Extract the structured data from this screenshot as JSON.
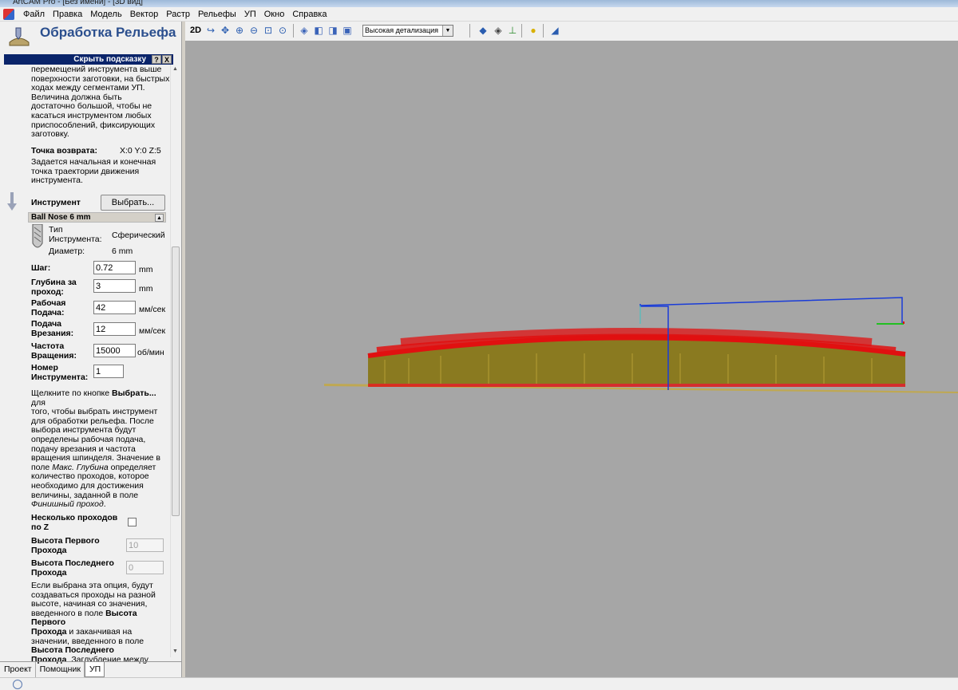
{
  "titlebar": {
    "text": "ArtCAM Pro - [Без имени] - [3D вид]"
  },
  "menu": [
    "Файл",
    "Правка",
    "Модель",
    "Вектор",
    "Растр",
    "Рельефы",
    "УП",
    "Окно",
    "Справка"
  ],
  "panel": {
    "title": "Обработка Рельефа",
    "hint_label": "Скрыть подсказку",
    "hint_help": "?",
    "hint_close": "X",
    "safe_z_lines": [
      "перемещений инструмента выше",
      "поверхности заготовки, на быстрых",
      "ходах между сегментами УП.",
      "Величина должна быть",
      "достаточно большой, чтобы не",
      "касаться инструментом любых",
      "приспособлений, фиксирующих",
      "заготовку."
    ],
    "home_label": "Точка возврата:",
    "home_value": "X:0 Y:0 Z:5",
    "home_lines": [
      "Задается начальная и конечная",
      "точка траектории движения",
      "инструмента."
    ],
    "tool_label": "Инструмент",
    "select_button": "Выбрать...",
    "tool_name": "Ball Nose 6 mm",
    "tool_type_label_1": "Тип",
    "tool_type_label_2": "Инструмента:",
    "tool_type_value": "Сферический",
    "tool_diameter_label": "Диаметр:",
    "tool_diameter_value": "6 mm",
    "step_label": "Шаг:",
    "step_value": "0.72",
    "step_unit": "mm",
    "depth_label_1": "Глубина за",
    "depth_label_2": "проход:",
    "depth_value": "3",
    "depth_unit": "mm",
    "feed_label_1": "Рабочая",
    "feed_label_2": "Подача:",
    "feed_value": "42",
    "feed_unit": "мм/сек",
    "plunge_label_1": "Подача",
    "plunge_label_2": "Врезания:",
    "plunge_value": "12",
    "plunge_unit": "мм/сек",
    "spindle_label_1": "Частота",
    "spindle_label_2": "Вращения:",
    "spindle_value": "15000",
    "spindle_unit": "об/мин",
    "toolnum_label_1": "Номер",
    "toolnum_label_2": "Инструмента:",
    "toolnum_value": "1",
    "help_lines": [
      "того, чтобы выбрать инструмент",
      "для обработки рельефа. После",
      "выбора инструмента будут",
      "определены рабочая подача,",
      "подачу врезания и частота",
      "вращения шпинделя. Значение в"
    ],
    "help_first_pre": "Щелкните по кнопке ",
    "help_first_bold": "Выбрать...",
    "help_first_post": " для",
    "help_maxdepth_pre": "поле ",
    "help_maxdepth_ital": "Макс. Глубина",
    "help_maxdepth_post": " определяет",
    "help_lines_2": [
      "количество проходов, которое",
      "необходимо для достижения",
      "величины, заданной в поле"
    ],
    "help_finish": "Финишный проход",
    "help_finish_dot": ".",
    "multi_label_1": "Несколько проходов",
    "multi_label_2": "по Z",
    "first_h_label_1": "Высота Первого",
    "first_h_label_2": "Прохода",
    "first_h_value": "10",
    "last_h_label_1": "Высота Последнего",
    "last_h_label_2": "Прохода",
    "last_h_value": "0",
    "opt_lines": [
      "Если выбрана эта опция, будут",
      "создаваться проходы на разной",
      "высоте, начиная со значения,"
    ],
    "opt_line4_pre": "введенного в поле ",
    "opt_line4_bold": "Высота Первого",
    "opt_line5_bold": "Прохода",
    "opt_line5_post": " и заканчивая на",
    "opt_line6": "значении, введенного в поле",
    "opt_line7_bold": "Высота Последнего",
    "opt_line8_bold": "Прохода",
    "opt_line8_post": " .Заглубление между"
  },
  "tabs": [
    "Проект",
    "Помощник",
    "УП"
  ],
  "toolbar": {
    "view2d": "2D",
    "detail": "Высокая детализация"
  },
  "colors": {
    "viewport": "#a6a6a6",
    "toolpath": "#e01010",
    "model": "#8a7a20",
    "rapid": "#1a3cd8",
    "hint_bar": "#0a246a",
    "panel_title": "#2b4f8e"
  }
}
